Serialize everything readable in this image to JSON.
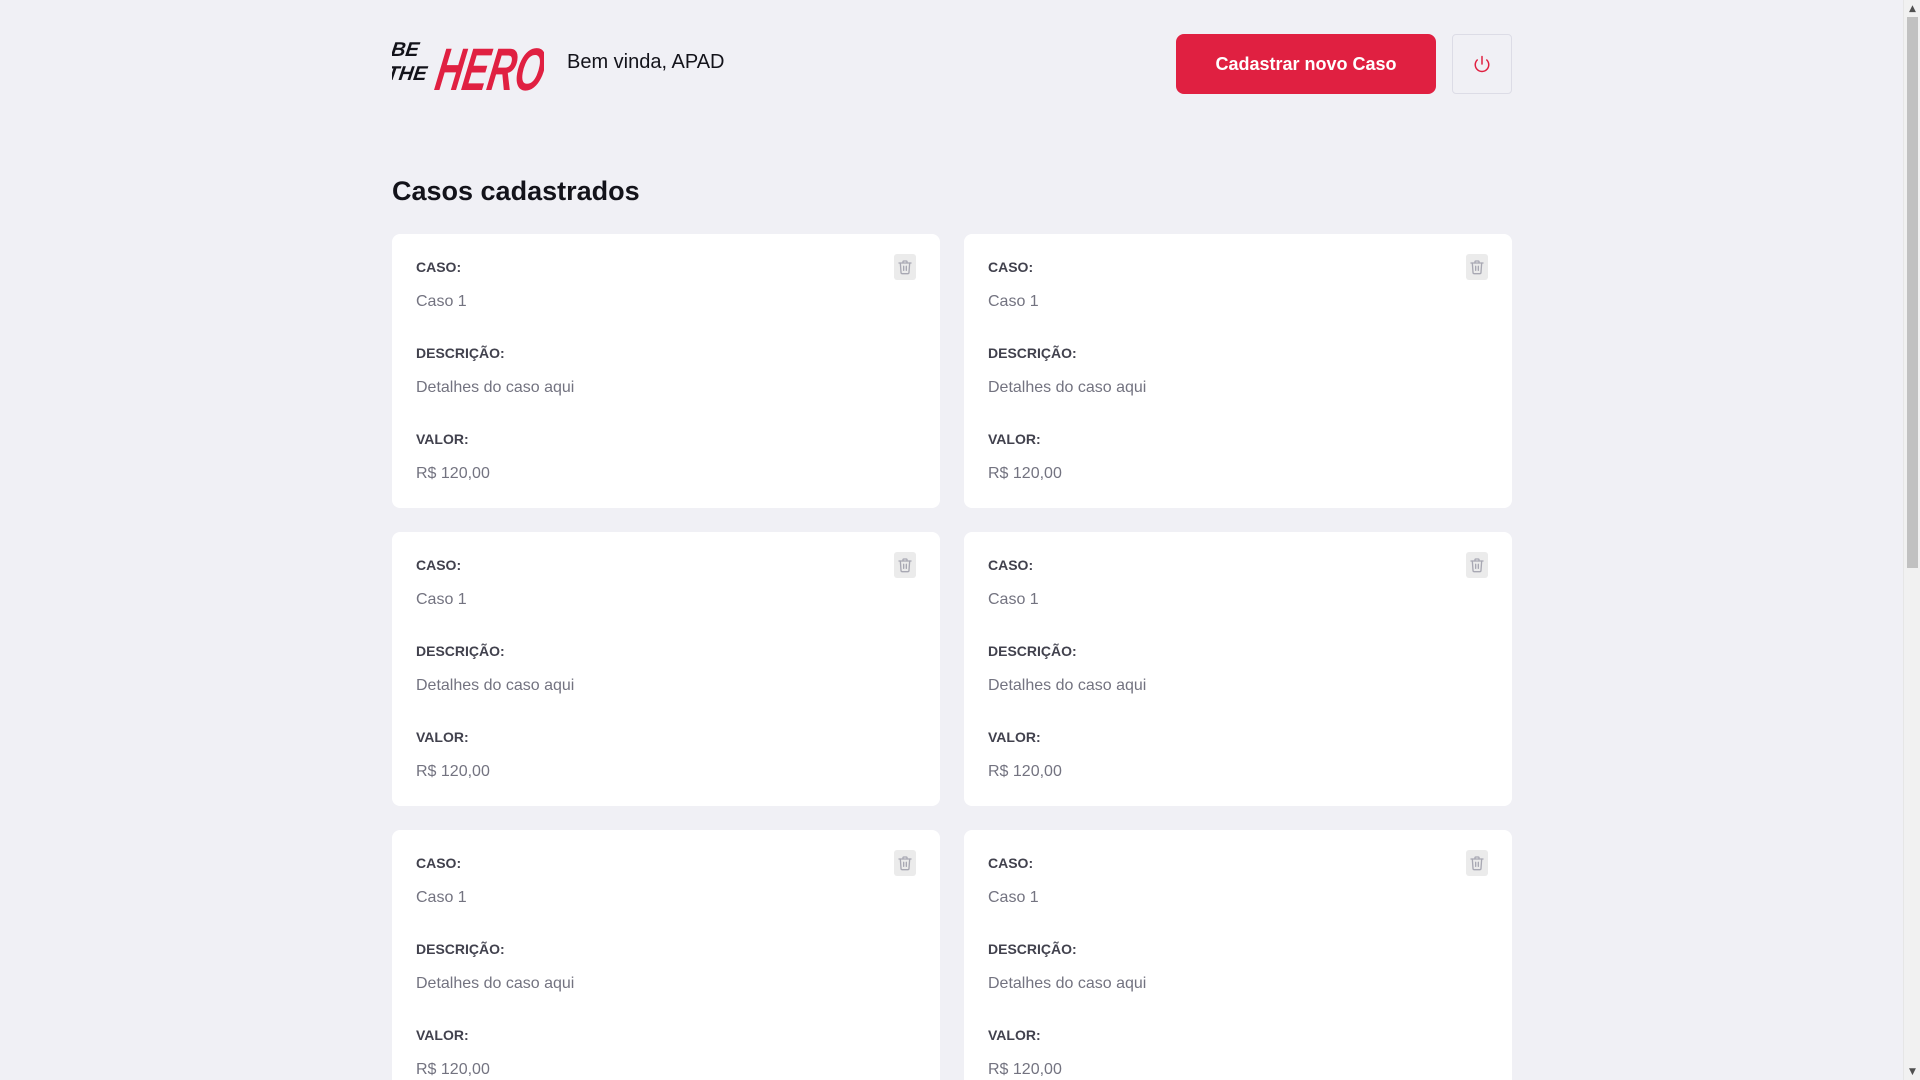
{
  "header": {
    "logo": {
      "line1": "BE",
      "line2": "THE",
      "word": "HERO"
    },
    "welcome": "Bem vinda, APAD",
    "new_case_label": "Cadastrar novo Caso"
  },
  "main": {
    "title": "Casos cadastrados",
    "cases": [
      {
        "case_label": "CASO:",
        "case_value": "Caso 1",
        "desc_label": "DESCRIÇÃO:",
        "desc_value": "Detalhes do caso aqui",
        "value_label": "VALOR:",
        "value_value": "R$ 120,00"
      },
      {
        "case_label": "CASO:",
        "case_value": "Caso 1",
        "desc_label": "DESCRIÇÃO:",
        "desc_value": "Detalhes do caso aqui",
        "value_label": "VALOR:",
        "value_value": "R$ 120,00"
      },
      {
        "case_label": "CASO:",
        "case_value": "Caso 1",
        "desc_label": "DESCRIÇÃO:",
        "desc_value": "Detalhes do caso aqui",
        "value_label": "VALOR:",
        "value_value": "R$ 120,00"
      },
      {
        "case_label": "CASO:",
        "case_value": "Caso 1",
        "desc_label": "DESCRIÇÃO:",
        "desc_value": "Detalhes do caso aqui",
        "value_label": "VALOR:",
        "value_value": "R$ 120,00"
      },
      {
        "case_label": "CASO:",
        "case_value": "Caso 1",
        "desc_label": "DESCRIÇÃO:",
        "desc_value": "Detalhes do caso aqui",
        "value_label": "VALOR:",
        "value_value": "R$ 120,00"
      },
      {
        "case_label": "CASO:",
        "case_value": "Caso 1",
        "desc_label": "DESCRIÇÃO:",
        "desc_value": "Detalhes do caso aqui",
        "value_label": "VALOR:",
        "value_value": "R$ 120,00"
      }
    ]
  },
  "colors": {
    "brand": "#e02041",
    "background": "#f0f0f5",
    "card": "#ffffff",
    "label": "#41414d",
    "muted": "#737380"
  },
  "icons": {
    "logout": "power-icon",
    "delete": "trash-icon"
  }
}
